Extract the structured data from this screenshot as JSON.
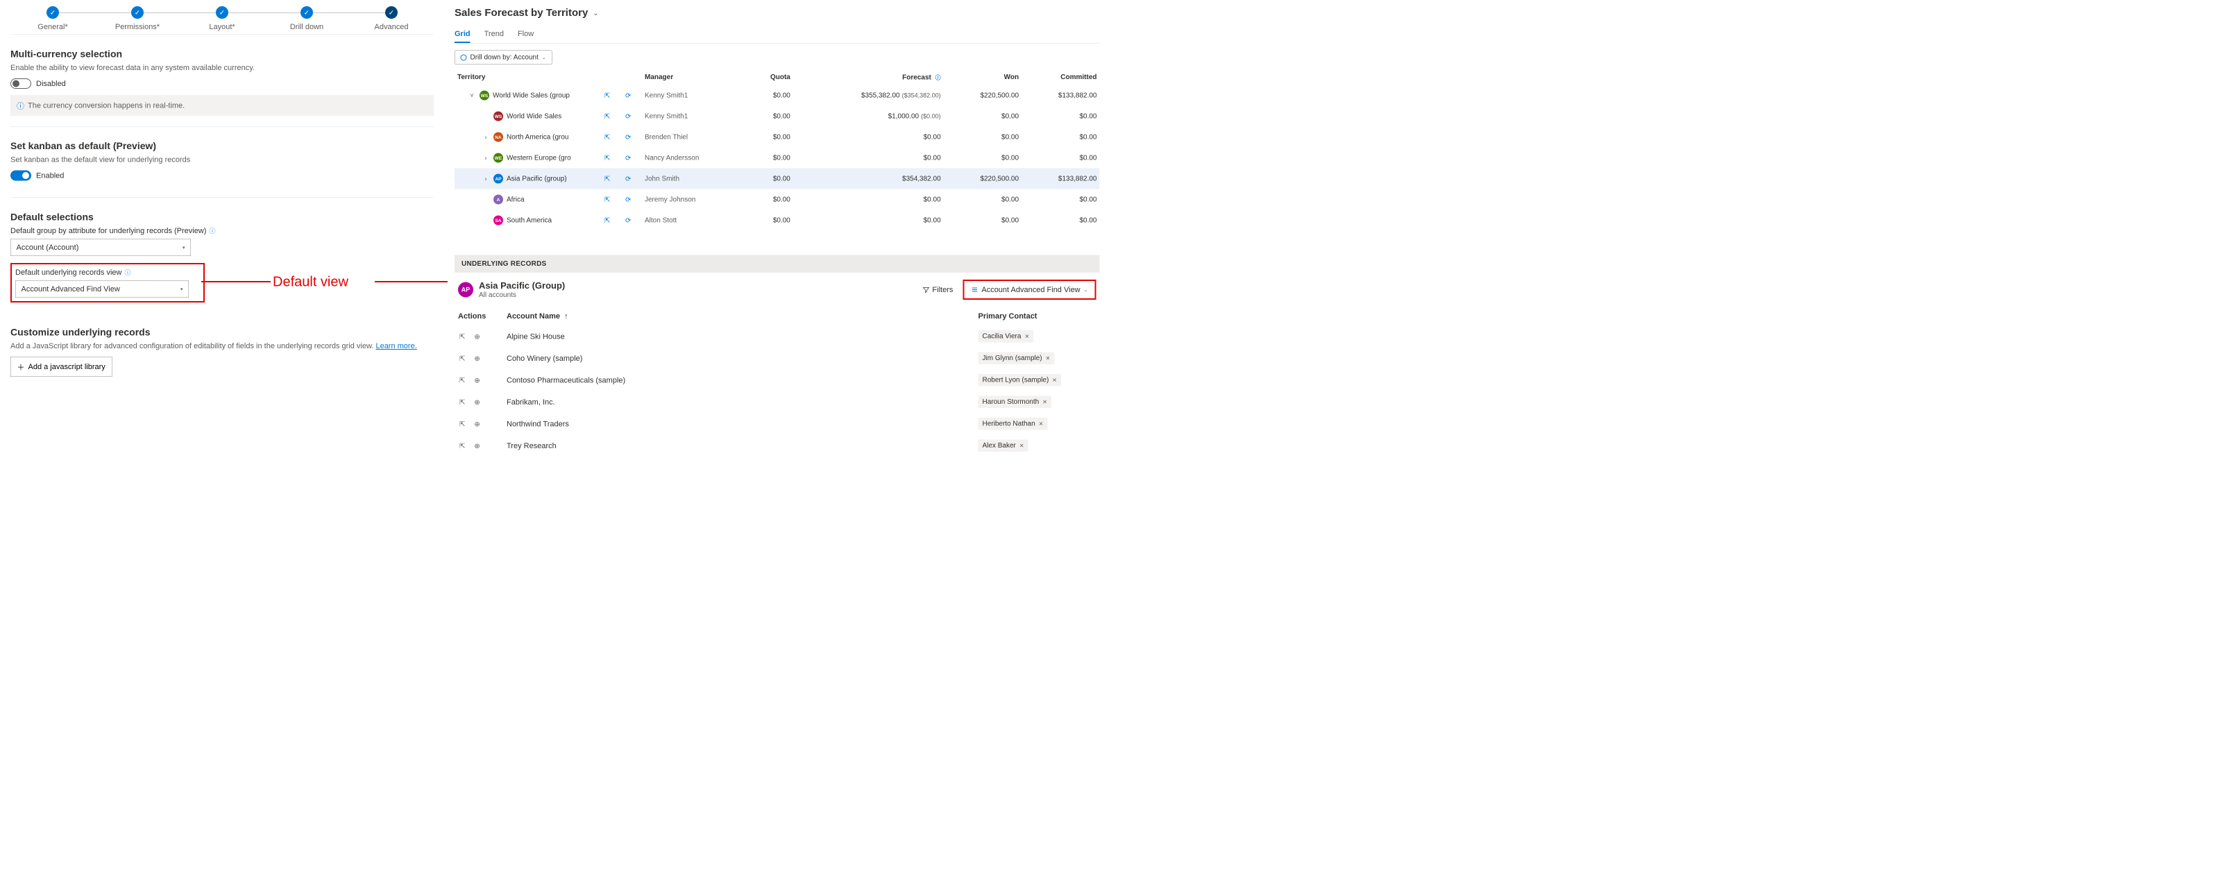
{
  "stepper": {
    "steps": [
      {
        "label": "General*"
      },
      {
        "label": "Permissions*"
      },
      {
        "label": "Layout*"
      },
      {
        "label": "Drill down"
      },
      {
        "label": "Advanced"
      }
    ]
  },
  "multiCurrency": {
    "title": "Multi-currency selection",
    "desc": "Enable the ability to view forecast data in any system available currency.",
    "toggleLabel": "Disabled",
    "note": "The currency conversion happens in real-time."
  },
  "kanban": {
    "title": "Set kanban as default (Preview)",
    "desc": "Set kanban as the default view for underlying records",
    "toggleLabel": "Enabled"
  },
  "defaultSelections": {
    "title": "Default selections",
    "groupByLabel": "Default group by attribute for underlying records (Preview)",
    "groupByValue": "Account (Account)",
    "viewLabel": "Default underlying records view",
    "viewValue": "Account Advanced Find View"
  },
  "customize": {
    "title": "Customize underlying records",
    "desc": "Add a JavaScript library for advanced configuration of editability of fields in the underlying records grid view. ",
    "learn": "Learn more.",
    "btn": "Add a javascript library"
  },
  "annotation": "Default view",
  "forecast": {
    "title": "Sales Forecast by Territory",
    "tabs": [
      "Grid",
      "Trend",
      "Flow"
    ],
    "drilldown": "Drill down by: Account",
    "columns": {
      "territory": "Territory",
      "manager": "Manager",
      "quota": "Quota",
      "forecast": "Forecast",
      "won": "Won",
      "committed": "Committed"
    },
    "rows": [
      {
        "indent": 0,
        "exp": "˅",
        "av": "WS",
        "avc": "#498205",
        "name": "World Wide Sales (group",
        "mgr": "Kenny Smith1",
        "quota": "$0.00",
        "fc": "$355,382.00",
        "fcsub": "($354,382.00)",
        "won": "$220,500.00",
        "com": "$133,882.00"
      },
      {
        "indent": 1,
        "exp": "",
        "av": "WS",
        "avc": "#a4262c",
        "name": "World Wide Sales",
        "mgr": "Kenny Smith1",
        "quota": "$0.00",
        "fc": "$1,000.00",
        "fcsub": "($0.00)",
        "won": "$0.00",
        "com": "$0.00"
      },
      {
        "indent": 1,
        "exp": "›",
        "av": "NA",
        "avc": "#ca5010",
        "name": "North America (grou",
        "mgr": "Brenden Thiel",
        "quota": "$0.00",
        "fc": "$0.00",
        "fcsub": "",
        "won": "$0.00",
        "com": "$0.00"
      },
      {
        "indent": 1,
        "exp": "›",
        "av": "WE",
        "avc": "#498205",
        "name": "Western Europe (gro",
        "mgr": "Nancy Andersson",
        "quota": "$0.00",
        "fc": "$0.00",
        "fcsub": "",
        "won": "$0.00",
        "com": "$0.00"
      },
      {
        "indent": 1,
        "exp": "›",
        "av": "AP",
        "avc": "#0078d4",
        "name": "Asia Pacific (group)",
        "mgr": "John Smith",
        "quota": "$0.00",
        "fc": "$354,382.00",
        "fcsub": "",
        "won": "$220,500.00",
        "com": "$133,882.00",
        "hl": true
      },
      {
        "indent": 1,
        "exp": "",
        "av": "A",
        "avc": "#8764b8",
        "name": "Africa",
        "mgr": "Jeremy Johnson",
        "quota": "$0.00",
        "fc": "$0.00",
        "fcsub": "",
        "won": "$0.00",
        "com": "$0.00"
      },
      {
        "indent": 1,
        "exp": "",
        "av": "SA",
        "avc": "#e3008c",
        "name": "South America",
        "mgr": "Alton Stott",
        "quota": "$0.00",
        "fc": "$0.00",
        "fcsub": "",
        "won": "$0.00",
        "com": "$0.00"
      }
    ]
  },
  "underlying": {
    "header": "UNDERLYING RECORDS",
    "groupAv": "AP",
    "groupTitle": "Asia Pacific (Group)",
    "groupSub": "All accounts",
    "filters": "Filters",
    "viewSel": "Account Advanced Find View",
    "cols": {
      "actions": "Actions",
      "name": "Account Name",
      "contact": "Primary Contact"
    },
    "rows": [
      {
        "name": "Alpine Ski House",
        "contact": "Cacilia Viera"
      },
      {
        "name": "Coho Winery (sample)",
        "contact": "Jim Glynn (sample)"
      },
      {
        "name": "Contoso Pharmaceuticals (sample)",
        "contact": "Robert Lyon (sample)"
      },
      {
        "name": "Fabrikam, Inc.",
        "contact": "Haroun Stormonth"
      },
      {
        "name": "Northwind Traders",
        "contact": "Heriberto Nathan"
      },
      {
        "name": "Trey Research",
        "contact": "Alex Baker"
      }
    ]
  }
}
